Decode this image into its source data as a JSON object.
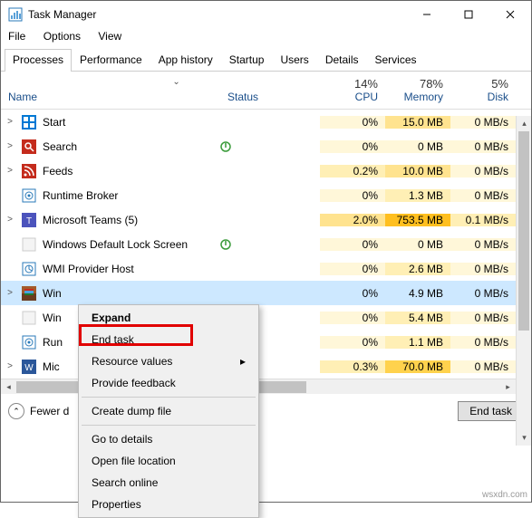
{
  "window": {
    "title": "Task Manager"
  },
  "menu": {
    "file": "File",
    "options": "Options",
    "view": "View"
  },
  "tabs": {
    "processes": "Processes",
    "performance": "Performance",
    "apphistory": "App history",
    "startup": "Startup",
    "users": "Users",
    "details": "Details",
    "services": "Services"
  },
  "columns": {
    "name": "Name",
    "status": "Status",
    "cpu": {
      "pct": "14%",
      "label": "CPU"
    },
    "memory": {
      "pct": "78%",
      "label": "Memory"
    },
    "disk": {
      "pct": "5%",
      "label": "Disk"
    }
  },
  "rows": [
    {
      "exp": true,
      "icon": "start-icon",
      "name": "Start",
      "status": "",
      "cpu": "0%",
      "mem": "15.0 MB",
      "disk": "0 MB/s",
      "cH": 0,
      "mH": 2,
      "dH": 0
    },
    {
      "exp": true,
      "icon": "search-icon",
      "name": "Search",
      "status": "leaf",
      "cpu": "0%",
      "mem": "0 MB",
      "disk": "0 MB/s",
      "cH": 0,
      "mH": 0,
      "dH": 0
    },
    {
      "exp": true,
      "icon": "feeds-icon",
      "name": "Feeds",
      "status": "",
      "cpu": "0.2%",
      "mem": "10.0 MB",
      "disk": "0 MB/s",
      "cH": 1,
      "mH": 2,
      "dH": 0
    },
    {
      "exp": false,
      "icon": "runtime-icon",
      "name": "Runtime Broker",
      "status": "",
      "cpu": "0%",
      "mem": "1.3 MB",
      "disk": "0 MB/s",
      "cH": 0,
      "mH": 1,
      "dH": 0
    },
    {
      "exp": true,
      "icon": "teams-icon",
      "name": "Microsoft Teams (5)",
      "status": "",
      "cpu": "2.0%",
      "mem": "753.5 MB",
      "disk": "0.1 MB/s",
      "cH": 2,
      "mH": 4,
      "dH": 1
    },
    {
      "exp": false,
      "icon": "blank-icon",
      "name": "Windows Default Lock Screen",
      "status": "leaf",
      "cpu": "0%",
      "mem": "0 MB",
      "disk": "0 MB/s",
      "cH": 0,
      "mH": 0,
      "dH": 0
    },
    {
      "exp": false,
      "icon": "wmi-icon",
      "name": "WMI Provider Host",
      "status": "",
      "cpu": "0%",
      "mem": "2.6 MB",
      "disk": "0 MB/s",
      "cH": 0,
      "mH": 1,
      "dH": 0
    },
    {
      "exp": true,
      "icon": "winrar-icon",
      "name": "Win",
      "status": "",
      "cpu": "0%",
      "mem": "4.9 MB",
      "disk": "0 MB/s",
      "cH": 0,
      "mH": 1,
      "dH": 0,
      "selected": true
    },
    {
      "exp": false,
      "icon": "blank-icon",
      "name": "Win",
      "status": "",
      "cpu": "0%",
      "mem": "5.4 MB",
      "disk": "0 MB/s",
      "cH": 0,
      "mH": 1,
      "dH": 0
    },
    {
      "exp": false,
      "icon": "runtime-icon",
      "name": "Run",
      "status": "",
      "cpu": "0%",
      "mem": "1.1 MB",
      "disk": "0 MB/s",
      "cH": 0,
      "mH": 1,
      "dH": 0
    },
    {
      "exp": true,
      "icon": "word-icon",
      "name": "Mic",
      "status": "",
      "cpu": "0.3%",
      "mem": "70.0 MB",
      "disk": "0 MB/s",
      "cH": 1,
      "mH": 3,
      "dH": 0
    }
  ],
  "context_menu": {
    "expand": "Expand",
    "endtask": "End task",
    "resource": "Resource values",
    "feedback": "Provide feedback",
    "dump": "Create dump file",
    "details": "Go to details",
    "openloc": "Open file location",
    "search": "Search online",
    "props": "Properties"
  },
  "footer": {
    "fewer": "Fewer d",
    "endtask": "End task"
  },
  "watermark": "wsxdn.com"
}
